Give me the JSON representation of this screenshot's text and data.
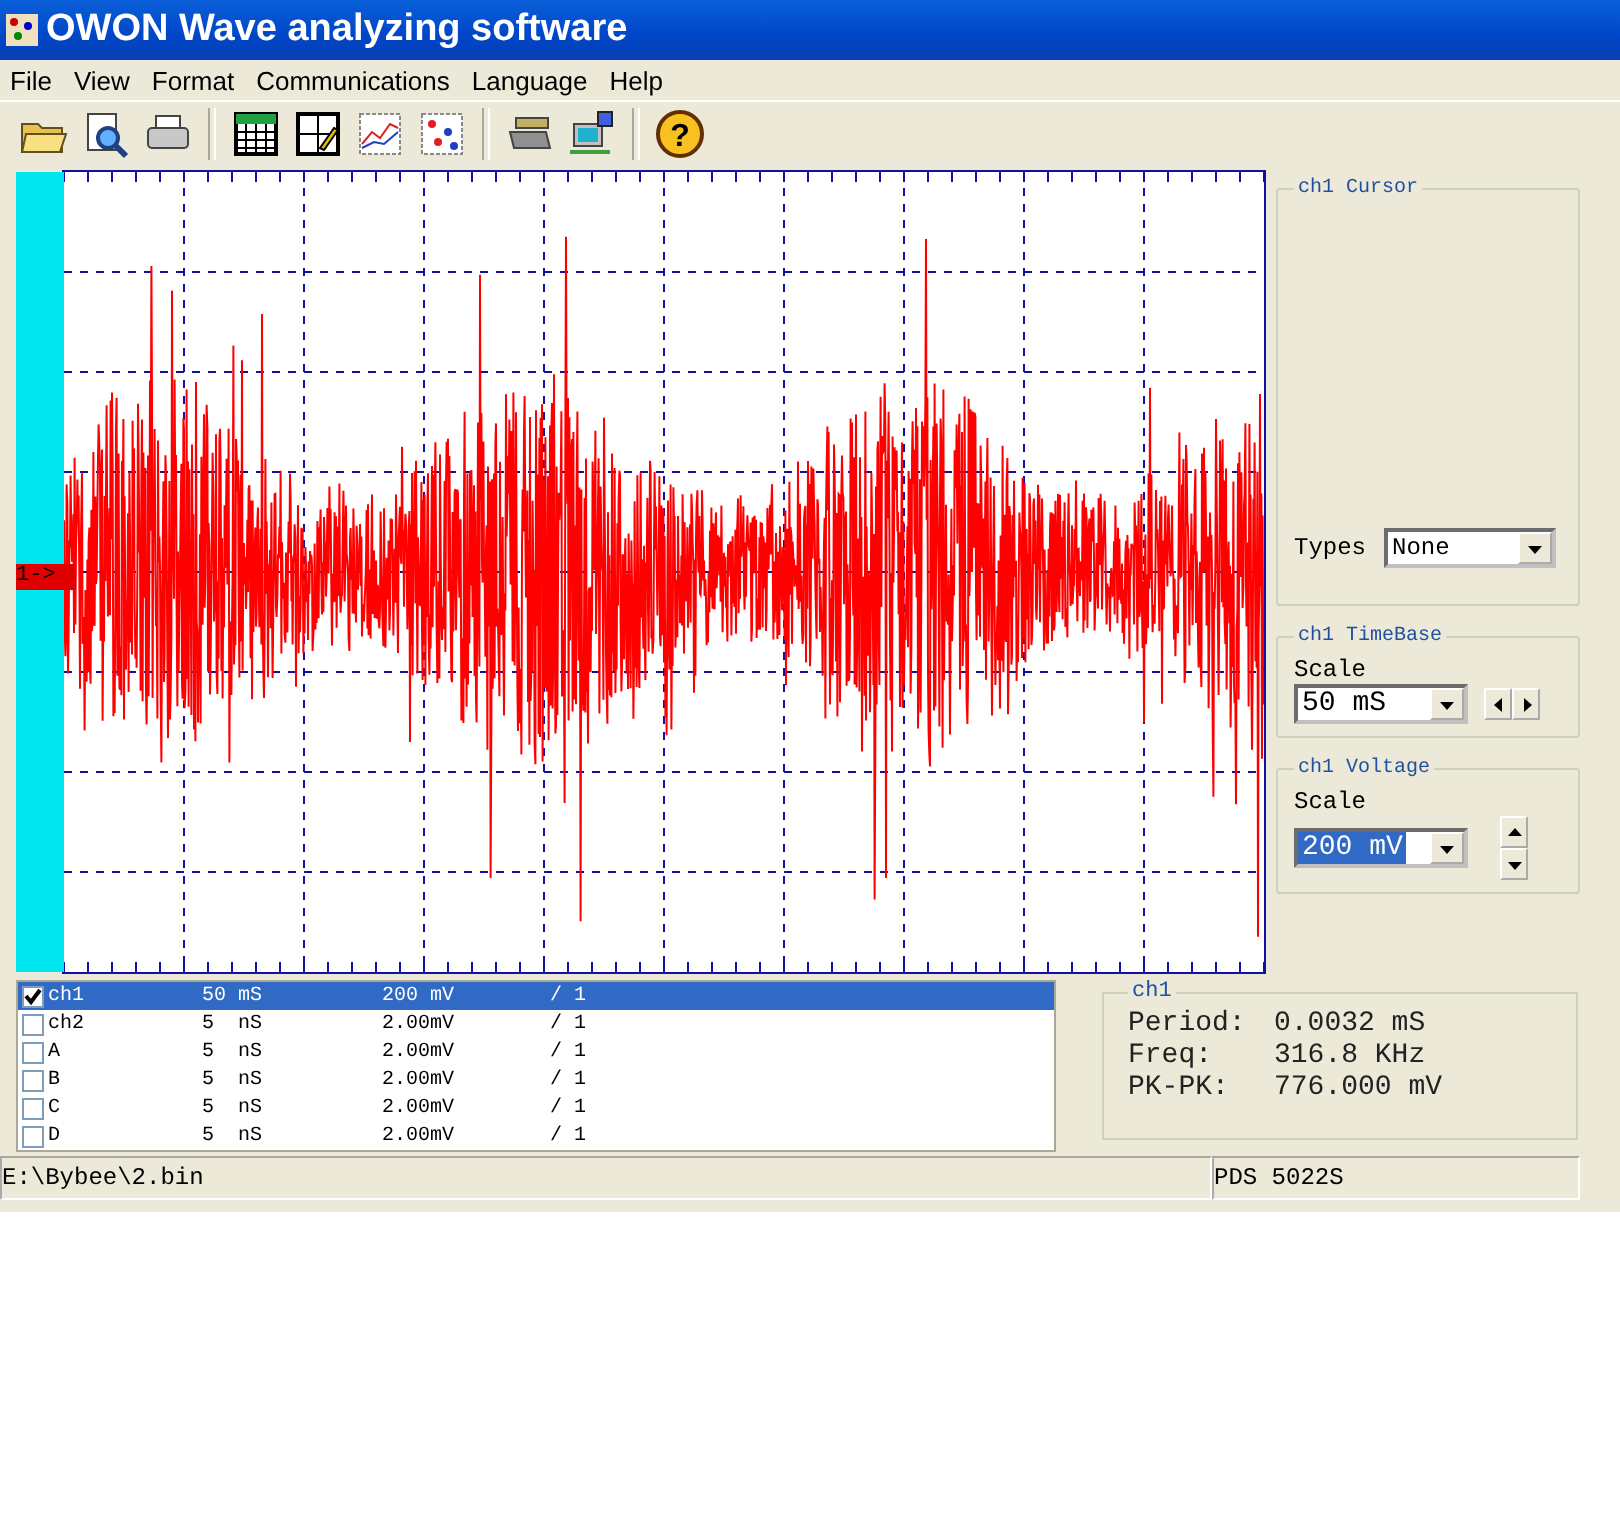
{
  "window": {
    "title": "OWON Wave analyzing software"
  },
  "menu": [
    "File",
    "View",
    "Format",
    "Communications",
    "Language",
    "Help"
  ],
  "toolbar": {
    "help_glyph": "?"
  },
  "scope": {
    "marker": "1->"
  },
  "channels": [
    {
      "name": "ch1",
      "timebase": "50 mS",
      "volts": "200 mV",
      "probe": "/ 1",
      "checked": true,
      "selected": true
    },
    {
      "name": "ch2",
      "timebase": "5  nS",
      "volts": "2.00mV",
      "probe": "/ 1",
      "checked": false,
      "selected": false
    },
    {
      "name": "A",
      "timebase": "5  nS",
      "volts": "2.00mV",
      "probe": "/ 1",
      "checked": false,
      "selected": false
    },
    {
      "name": "B",
      "timebase": "5  nS",
      "volts": "2.00mV",
      "probe": "/ 1",
      "checked": false,
      "selected": false
    },
    {
      "name": "C",
      "timebase": "5  nS",
      "volts": "2.00mV",
      "probe": "/ 1",
      "checked": false,
      "selected": false
    },
    {
      "name": "D",
      "timebase": "5  nS",
      "volts": "2.00mV",
      "probe": "/ 1",
      "checked": false,
      "selected": false
    }
  ],
  "cursor": {
    "title": "ch1 Cursor",
    "label": "Types",
    "value": "None"
  },
  "timebase": {
    "title": "ch1 TimeBase",
    "label": "Scale",
    "value": "50 mS"
  },
  "voltage": {
    "title": "ch1 Voltage",
    "label": "Scale",
    "value": "200 mV",
    "value_selected": true
  },
  "measurements": {
    "title": "ch1",
    "rows": [
      {
        "label": "Period:",
        "value": "0.0032 mS"
      },
      {
        "label": "Freq:",
        "value": "316.8 KHz"
      },
      {
        "label": "PK-PK:",
        "value": "776.000 mV"
      }
    ]
  },
  "status_bar": {
    "path": "E:\\Bybee\\2.bin",
    "device": "PDS 5022S"
  }
}
